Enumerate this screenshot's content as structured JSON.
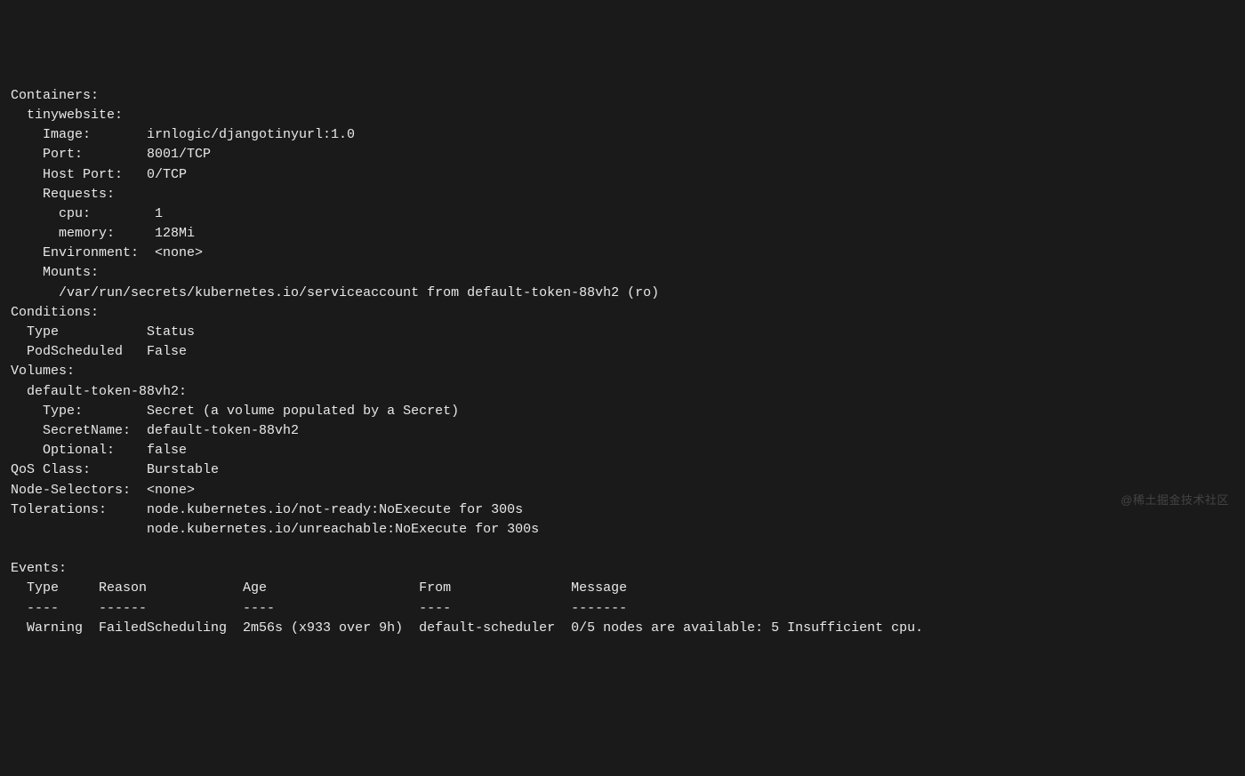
{
  "containers": {
    "header": "Containers:",
    "name_indent": "  tinywebsite:",
    "image_line": "    Image:       irnlogic/djangotinyurl:1.0",
    "port_line": "    Port:        8001/TCP",
    "hostport_line": "    Host Port:   0/TCP",
    "requests_header": "    Requests:",
    "cpu_line": "      cpu:        1",
    "memory_line": "      memory:     128Mi",
    "env_line": "    Environment:  <none>",
    "mounts_header": "    Mounts:",
    "mounts_path": "      /var/run/secrets/kubernetes.io/serviceaccount from default-token-88vh2 (ro)"
  },
  "conditions": {
    "header": "Conditions:",
    "row_header": "  Type           Status",
    "row_1": "  PodScheduled   False"
  },
  "volumes": {
    "header": "Volumes:",
    "name": "  default-token-88vh2:",
    "type": "    Type:        Secret (a volume populated by a Secret)",
    "secretname": "    SecretName:  default-token-88vh2",
    "optional": "    Optional:    false"
  },
  "qos_line": "QoS Class:       Burstable",
  "nodeselectors_line": "Node-Selectors:  <none>",
  "tolerations_line1": "Tolerations:     node.kubernetes.io/not-ready:NoExecute for 300s",
  "tolerations_line2": "                 node.kubernetes.io/unreachable:NoExecute for 300s",
  "events": {
    "header": "Events:",
    "columns": "  Type     Reason            Age                   From               Message",
    "divider": "  ----     ------            ----                  ----               -------",
    "row_1": "  Warning  FailedScheduling  2m56s (x933 over 9h)  default-scheduler  0/5 nodes are available: 5 Insufficient cpu."
  },
  "watermark": "@稀土掘金技术社区"
}
